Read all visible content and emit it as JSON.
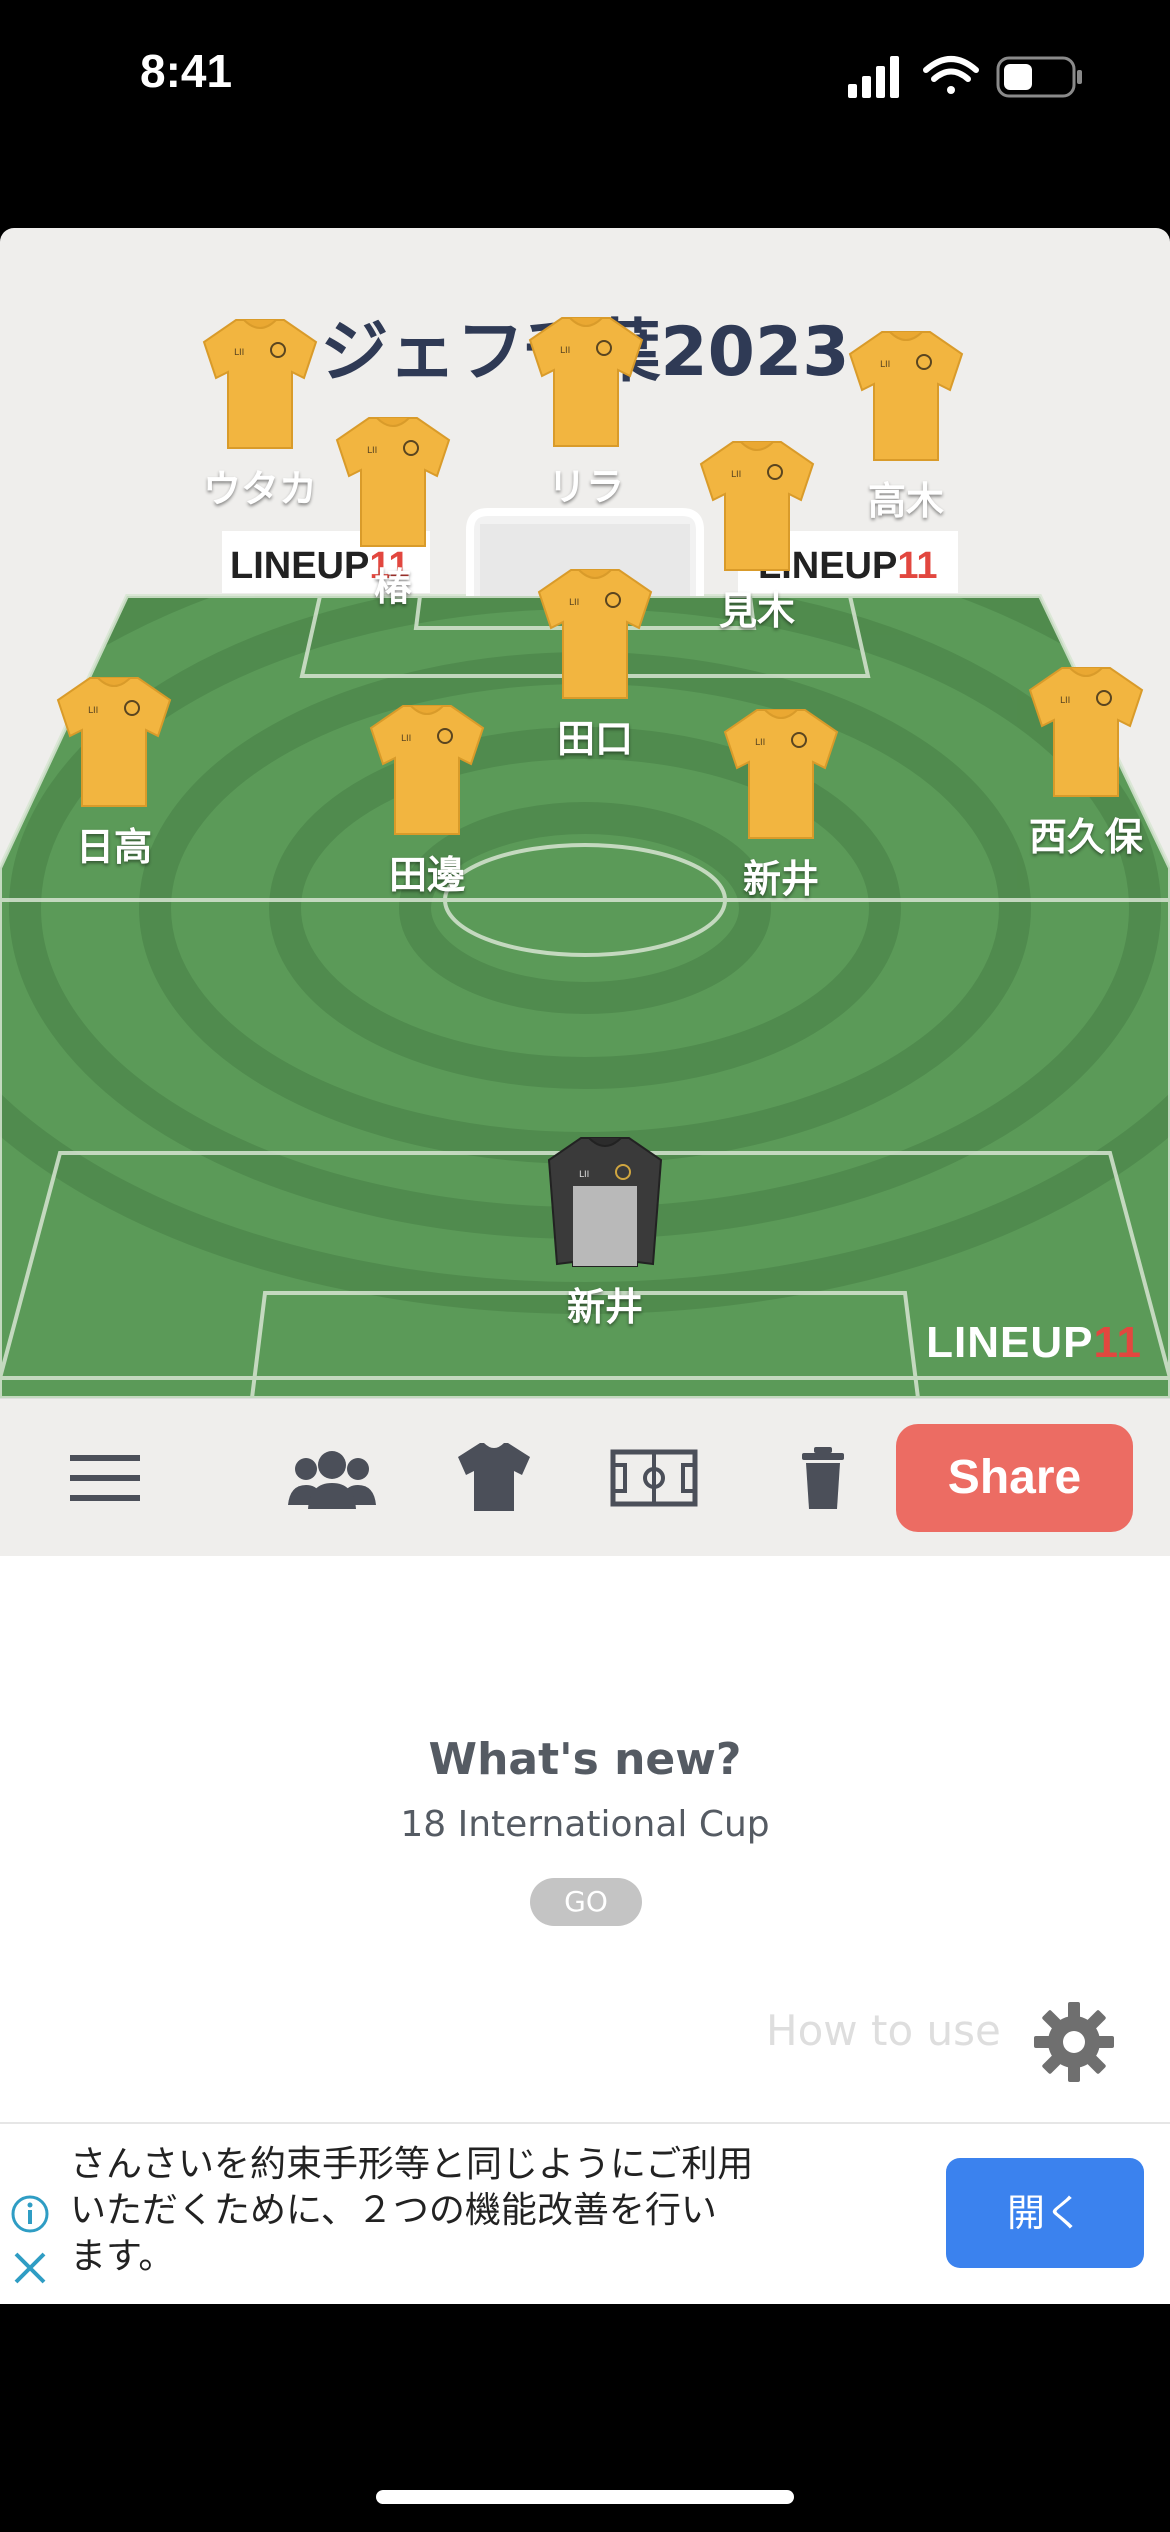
{
  "status_bar": {
    "time": "8:41"
  },
  "team": {
    "title": "ジェフ千葉2023"
  },
  "pitch": {
    "ad_boards": [
      "LINEUP11",
      "LINEUP11"
    ],
    "watermark_text": "LINEUP",
    "watermark_number": "11"
  },
  "players": [
    {
      "name": "ウタカ",
      "kit": "field"
    },
    {
      "name": "リラ",
      "kit": "field"
    },
    {
      "name": "高木",
      "kit": "field"
    },
    {
      "name": "椿",
      "kit": "field"
    },
    {
      "name": "見木",
      "kit": "field"
    },
    {
      "name": "田口",
      "kit": "field"
    },
    {
      "name": "日高",
      "kit": "field"
    },
    {
      "name": "田邊",
      "kit": "field"
    },
    {
      "name": "新井",
      "kit": "field"
    },
    {
      "name": "西久保",
      "kit": "field"
    },
    {
      "name": "新井",
      "kit": "goalkeeper"
    }
  ],
  "toolbar": {
    "icons": [
      "menu-icon",
      "players-icon",
      "shirt-icon",
      "pitch-icon",
      "trash-icon"
    ],
    "share_label": "Share"
  },
  "news": {
    "heading": "What's new?",
    "subtitle": "18 International Cup",
    "go_label": "GO"
  },
  "help": {
    "how_to_use": "How to use"
  },
  "ad": {
    "lines": [
      "さんさいを約束手形等と同じようにご利用",
      "いただくために、２つの機能改善を行い",
      "ます。"
    ],
    "open_label": "開く"
  },
  "colors": {
    "kit_field": "#f2b540",
    "kit_goalkeeper": "#3a3a3a",
    "pitch_green": "#5b9a58",
    "share_button": "#ec6c63",
    "ad_button": "#3b82ee",
    "title_text": "#2f3a55"
  }
}
